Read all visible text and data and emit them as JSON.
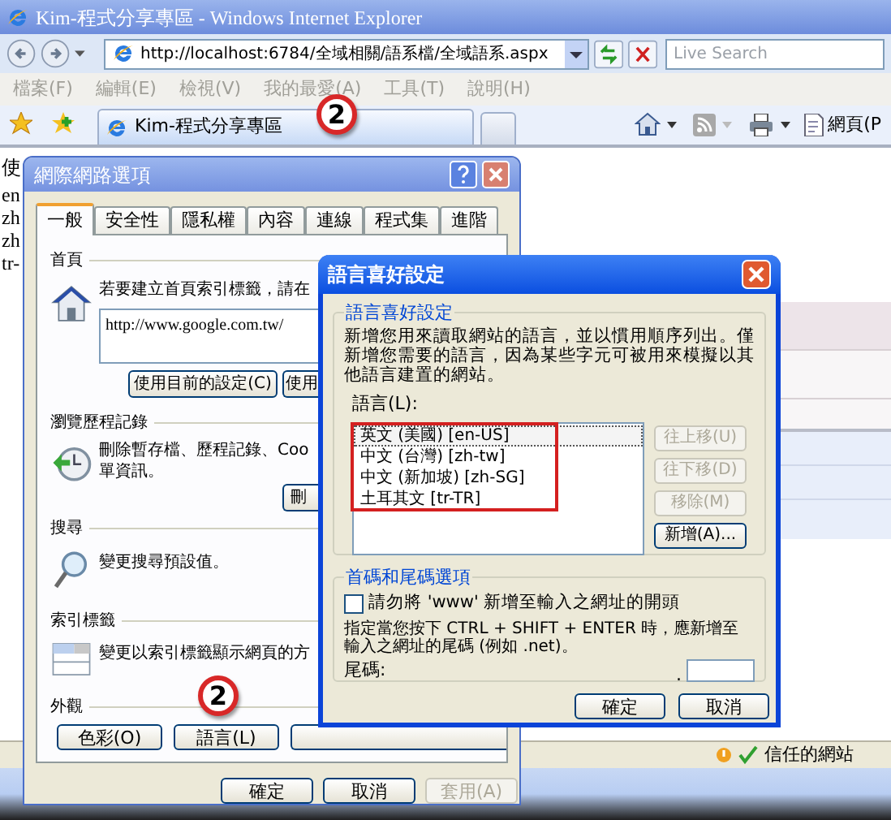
{
  "browser": {
    "title": "Kim-程式分享專區 - Windows Internet Explorer",
    "address": "http://localhost:6784/全域相關/語系檔/全域語系.aspx",
    "search_placeholder": "Live Search",
    "menu": [
      "檔案(F)",
      "編輯(E)",
      "檢視(V)",
      "我的最愛(A)",
      "工具(T)",
      "說明(H)"
    ],
    "tabs": [
      {
        "label": "Kim-程式分享專區",
        "selected": true
      }
    ],
    "command_label": "網頁(P",
    "page_lines": [
      "使",
      "en",
      "zh",
      "zh",
      "tr-"
    ],
    "status_zone": "信任的網站"
  },
  "callouts": [
    "2",
    "2"
  ],
  "internet_options": {
    "title": "網際網路選項",
    "tabs": [
      {
        "label": "一般",
        "selected": true
      },
      {
        "label": "安全性",
        "selected": false
      },
      {
        "label": "隱私權",
        "selected": false
      },
      {
        "label": "內容",
        "selected": false
      },
      {
        "label": "連線",
        "selected": false
      },
      {
        "label": "程式集",
        "selected": false
      },
      {
        "label": "進階",
        "selected": false
      }
    ],
    "home_page": {
      "heading": "首頁",
      "text": "若要建立首頁索引標籤，請在",
      "url": "http://www.google.com.tw/",
      "buttons": [
        "使用目前的設定(C)",
        "使用"
      ]
    },
    "history": {
      "heading": "瀏覽歷程記錄",
      "lines": [
        "刪除暫存檔、歷程記錄、Coo",
        "單資訊。"
      ],
      "button": "刪"
    },
    "search": {
      "heading": "搜尋",
      "text": "變更搜尋預設值。"
    },
    "tab_settings": {
      "heading": "索引標籤",
      "text": "變更以索引標籤顯示網頁的方"
    },
    "appearance": {
      "heading": "外觀",
      "buttons": [
        "色彩(O)",
        "語言(L)"
      ]
    },
    "buttons": [
      {
        "label": "確定",
        "disabled": false
      },
      {
        "label": "取消",
        "disabled": false
      },
      {
        "label": "套用(A)",
        "disabled": true
      }
    ]
  },
  "language_preference": {
    "title": "語言喜好設定",
    "group": "語言喜好設定",
    "description": "新增您用來讀取網站的語言，並以慣用順序列出。僅新增您需要的語言，因為某些字元可被用來模擬以其他語言建置的網站。",
    "list_label": "語言(L):",
    "languages": [
      {
        "label": "英文 (美國) [en-US]",
        "selected": true
      },
      {
        "label": "中文 (台灣) [zh-tw]",
        "selected": false
      },
      {
        "label": "中文 (新加坡) [zh-SG]",
        "selected": false
      },
      {
        "label": "土耳其文 [tr-TR]",
        "selected": false
      }
    ],
    "list_buttons": [
      {
        "label": "往上移(U)",
        "disabled": true
      },
      {
        "label": "往下移(D)",
        "disabled": true
      },
      {
        "label": "移除(M)",
        "disabled": true
      },
      {
        "label": "新增(A)...",
        "disabled": false
      }
    ],
    "suffix_group": "首碼和尾碼選項",
    "www_option": {
      "label": "請勿將 'www' 新增至輸入之網址的開頭",
      "checked": false
    },
    "suffix_note": "指定當您按下 CTRL + SHIFT + ENTER 時，應新增至輸入之網址的尾碼 (例如 .net)。",
    "suffix_label": "尾碼:",
    "suffix_dot": ".",
    "buttons": [
      {
        "label": "確定",
        "disabled": false
      },
      {
        "label": "取消",
        "disabled": false
      }
    ]
  }
}
